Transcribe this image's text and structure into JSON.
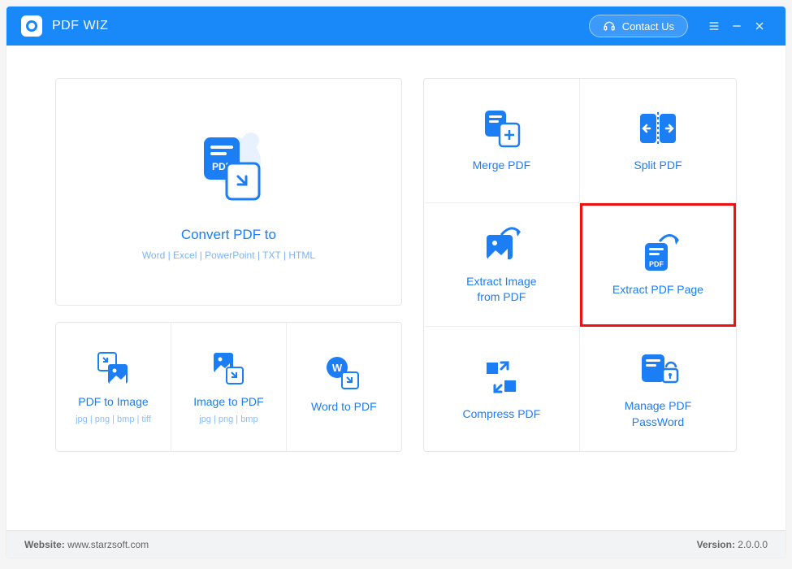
{
  "titlebar": {
    "app_name": "PDF WIZ",
    "contact_label": "Contact Us"
  },
  "left": {
    "convert": {
      "title": "Convert PDF to",
      "sub": "Word | Excel | PowerPoint | TXT | HTML"
    },
    "row": [
      {
        "title": "PDF to Image",
        "sub": "jpg | png | bmp | tiff"
      },
      {
        "title": "Image to PDF",
        "sub": "jpg | png | bmp"
      },
      {
        "title": "Word to PDF",
        "sub": ""
      }
    ]
  },
  "right": {
    "tiles": [
      {
        "title": "Merge PDF"
      },
      {
        "title": "Split PDF"
      },
      {
        "title": "Extract Image\nfrom PDF"
      },
      {
        "title": "Extract PDF Page",
        "highlight": true
      },
      {
        "title": "Compress PDF"
      },
      {
        "title": "Manage PDF\nPassWord"
      }
    ]
  },
  "footer": {
    "website_label": "Website:",
    "website_url": "www.starzsoft.com",
    "version_label": "Version:",
    "version": "2.0.0.0"
  }
}
